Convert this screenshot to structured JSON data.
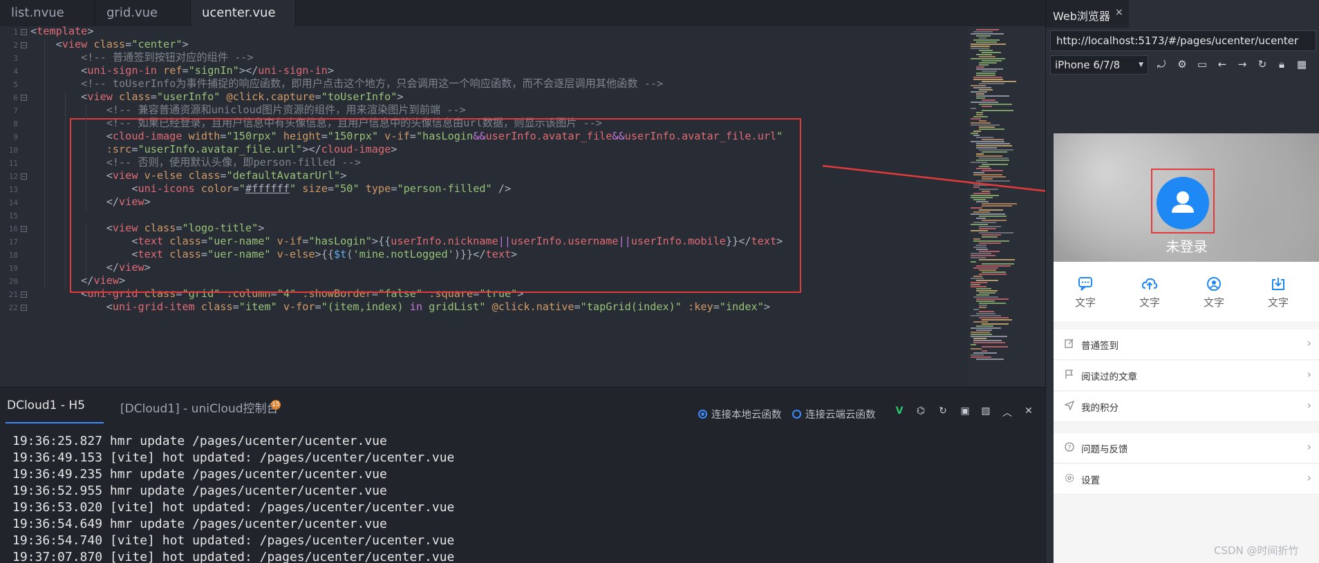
{
  "editor": {
    "tabs": [
      "list.nvue",
      "grid.vue",
      "ucenter.vue"
    ],
    "active_tab": "ucenter.vue",
    "line_numbers": [
      "1",
      "2",
      "3",
      "4",
      "5",
      "6",
      "7",
      "8",
      "9",
      "10",
      "11",
      "12",
      "13",
      "14",
      "15",
      "16",
      "17",
      "18",
      "19",
      "20",
      "21",
      "22"
    ],
    "lines": [
      [
        [
          "t-punc",
          "<"
        ],
        [
          "t-tag",
          "template"
        ],
        [
          "t-punc",
          ">"
        ]
      ],
      [
        [
          "t-plain",
          "    "
        ],
        [
          "t-punc",
          "<"
        ],
        [
          "t-tag",
          "view"
        ],
        [
          "t-plain",
          " "
        ],
        [
          "t-attr",
          "class"
        ],
        [
          "t-punc",
          "="
        ],
        [
          "t-str",
          "\"center\""
        ],
        [
          "t-punc",
          ">"
        ]
      ],
      [
        [
          "t-plain",
          "        "
        ],
        [
          "t-cmt",
          "<!-- 普通签到按钮对应的组件 -->"
        ]
      ],
      [
        [
          "t-plain",
          "        "
        ],
        [
          "t-punc",
          "<"
        ],
        [
          "t-tag",
          "uni-sign-in"
        ],
        [
          "t-plain",
          " "
        ],
        [
          "t-attr",
          "ref"
        ],
        [
          "t-punc",
          "="
        ],
        [
          "t-str",
          "\"signIn\""
        ],
        [
          "t-punc",
          "></"
        ],
        [
          "t-tag",
          "uni-sign-in"
        ],
        [
          "t-punc",
          ">"
        ]
      ],
      [
        [
          "t-plain",
          "        "
        ],
        [
          "t-cmt",
          "<!-- toUserInfo为事件捕捉的响应函数，即用户点击这个地方，只会调用这一个响应函数，而不会逐层调用其他函数 -->"
        ]
      ],
      [
        [
          "t-plain",
          "        "
        ],
        [
          "t-punc",
          "<"
        ],
        [
          "t-tag",
          "view"
        ],
        [
          "t-plain",
          " "
        ],
        [
          "t-attr",
          "class"
        ],
        [
          "t-punc",
          "="
        ],
        [
          "t-str",
          "\"userInfo\""
        ],
        [
          "t-plain",
          " "
        ],
        [
          "t-attr",
          "@click.capture"
        ],
        [
          "t-punc",
          "="
        ],
        [
          "t-str",
          "\"toUserInfo\""
        ],
        [
          "t-punc",
          ">"
        ]
      ],
      [
        [
          "t-plain",
          "            "
        ],
        [
          "t-cmt",
          "<!-- 兼容普通资源和unicloud图片资源的组件，用来渲染图片到前端 -->"
        ]
      ],
      [
        [
          "t-plain",
          "            "
        ],
        [
          "t-cmt",
          "<!-- 如果已经登录，且用户信息中有头像信息，且用户信息中的头像信息由url数据，则显示该图片 -->"
        ]
      ],
      [
        [
          "t-plain",
          "            "
        ],
        [
          "t-punc",
          "<"
        ],
        [
          "t-tag",
          "cloud-image"
        ],
        [
          "t-plain",
          " "
        ],
        [
          "t-attr",
          "width"
        ],
        [
          "t-punc",
          "="
        ],
        [
          "t-str",
          "\"150rpx\""
        ],
        [
          "t-plain",
          " "
        ],
        [
          "t-attr",
          "height"
        ],
        [
          "t-punc",
          "="
        ],
        [
          "t-str",
          "\"150rpx\""
        ],
        [
          "t-plain",
          " "
        ],
        [
          "t-attr",
          "v-if"
        ],
        [
          "t-punc",
          "="
        ],
        [
          "t-str",
          "\"hasLogin"
        ],
        [
          "t-kw",
          "&&"
        ],
        [
          "t-id",
          "userInfo.avatar_file"
        ],
        [
          "t-kw",
          "&&"
        ],
        [
          "t-id",
          "userInfo.avatar_file.url"
        ],
        [
          "t-str",
          "\""
        ]
      ],
      [
        [
          "t-plain",
          "            "
        ],
        [
          "t-attr",
          ":src"
        ],
        [
          "t-punc",
          "="
        ],
        [
          "t-str",
          "\"userInfo.avatar_file.url\""
        ],
        [
          "t-punc",
          "></"
        ],
        [
          "t-tag",
          "cloud-image"
        ],
        [
          "t-punc",
          ">"
        ]
      ],
      [
        [
          "t-plain",
          "            "
        ],
        [
          "t-cmt",
          "<!-- 否则，使用默认头像，即person-filled -->"
        ]
      ],
      [
        [
          "t-plain",
          "            "
        ],
        [
          "t-punc",
          "<"
        ],
        [
          "t-tag",
          "view"
        ],
        [
          "t-plain",
          " "
        ],
        [
          "t-attr",
          "v-else"
        ],
        [
          "t-plain",
          " "
        ],
        [
          "t-attr",
          "class"
        ],
        [
          "t-punc",
          "="
        ],
        [
          "t-str",
          "\"defaultAvatarUrl\""
        ],
        [
          "t-punc",
          ">"
        ]
      ],
      [
        [
          "t-plain",
          "                "
        ],
        [
          "t-punc",
          "<"
        ],
        [
          "t-tag",
          "uni-icons"
        ],
        [
          "t-plain",
          " "
        ],
        [
          "t-attr",
          "color"
        ],
        [
          "t-punc",
          "="
        ],
        [
          "t-str",
          "\""
        ],
        [
          "t-plain u",
          "#ffffff"
        ],
        [
          "t-str",
          "\""
        ],
        [
          "t-plain",
          " "
        ],
        [
          "t-attr",
          "size"
        ],
        [
          "t-punc",
          "="
        ],
        [
          "t-str",
          "\"50\""
        ],
        [
          "t-plain",
          " "
        ],
        [
          "t-attr",
          "type"
        ],
        [
          "t-punc",
          "="
        ],
        [
          "t-str",
          "\"person-filled\""
        ],
        [
          "t-plain",
          " "
        ],
        [
          "t-punc",
          "/>"
        ]
      ],
      [
        [
          "t-plain",
          "            "
        ],
        [
          "t-punc",
          "</"
        ],
        [
          "t-tag",
          "view"
        ],
        [
          "t-punc",
          ">"
        ]
      ],
      [],
      [
        [
          "t-plain",
          "            "
        ],
        [
          "t-punc",
          "<"
        ],
        [
          "t-tag",
          "view"
        ],
        [
          "t-plain",
          " "
        ],
        [
          "t-attr",
          "class"
        ],
        [
          "t-punc",
          "="
        ],
        [
          "t-str",
          "\"logo-title\""
        ],
        [
          "t-punc",
          ">"
        ]
      ],
      [
        [
          "t-plain",
          "                "
        ],
        [
          "t-punc",
          "<"
        ],
        [
          "t-tag",
          "text"
        ],
        [
          "t-plain",
          " "
        ],
        [
          "t-attr",
          "class"
        ],
        [
          "t-punc",
          "="
        ],
        [
          "t-str",
          "\"uer-name\""
        ],
        [
          "t-plain",
          " "
        ],
        [
          "t-attr",
          "v-if"
        ],
        [
          "t-punc",
          "="
        ],
        [
          "t-str",
          "\"hasLogin\""
        ],
        [
          "t-punc",
          ">{{"
        ],
        [
          "t-id",
          "userInfo.nickname"
        ],
        [
          "t-kw",
          "||"
        ],
        [
          "t-id",
          "userInfo.username"
        ],
        [
          "t-kw",
          "||"
        ],
        [
          "t-id",
          "userInfo.mobile"
        ],
        [
          "t-punc",
          "}}</"
        ],
        [
          "t-tag",
          "text"
        ],
        [
          "t-punc",
          ">"
        ]
      ],
      [
        [
          "t-plain",
          "                "
        ],
        [
          "t-punc",
          "<"
        ],
        [
          "t-tag",
          "text"
        ],
        [
          "t-plain",
          " "
        ],
        [
          "t-attr",
          "class"
        ],
        [
          "t-punc",
          "="
        ],
        [
          "t-str",
          "\"uer-name\""
        ],
        [
          "t-plain",
          " "
        ],
        [
          "t-attr",
          "v-else"
        ],
        [
          "t-punc",
          ">{{"
        ],
        [
          "t-fn",
          "$t"
        ],
        [
          "t-punc",
          "("
        ],
        [
          "t-str",
          "'mine.notLogged'"
        ],
        [
          "t-punc",
          ")}}</"
        ],
        [
          "t-tag",
          "text"
        ],
        [
          "t-punc",
          ">"
        ]
      ],
      [
        [
          "t-plain",
          "            "
        ],
        [
          "t-punc",
          "</"
        ],
        [
          "t-tag",
          "view"
        ],
        [
          "t-punc",
          ">"
        ]
      ],
      [
        [
          "t-plain",
          "        "
        ],
        [
          "t-punc",
          "</"
        ],
        [
          "t-tag",
          "view"
        ],
        [
          "t-punc",
          ">"
        ]
      ],
      [
        [
          "t-plain",
          "        "
        ],
        [
          "t-punc",
          "<"
        ],
        [
          "t-tag",
          "uni-grid"
        ],
        [
          "t-plain",
          " "
        ],
        [
          "t-attr",
          "class"
        ],
        [
          "t-punc",
          "="
        ],
        [
          "t-str",
          "\"grid\""
        ],
        [
          "t-plain",
          " "
        ],
        [
          "t-attr",
          ":column"
        ],
        [
          "t-punc",
          "="
        ],
        [
          "t-str",
          "\"4\""
        ],
        [
          "t-plain",
          " "
        ],
        [
          "t-attr",
          ":showBorder"
        ],
        [
          "t-punc",
          "="
        ],
        [
          "t-str",
          "\"false\""
        ],
        [
          "t-plain",
          " "
        ],
        [
          "t-attr",
          ":square"
        ],
        [
          "t-punc",
          "="
        ],
        [
          "t-str",
          "\"true\""
        ],
        [
          "t-punc",
          ">"
        ]
      ],
      [
        [
          "t-plain",
          "            "
        ],
        [
          "t-punc",
          "<"
        ],
        [
          "t-tag",
          "uni-grid-item"
        ],
        [
          "t-plain",
          " "
        ],
        [
          "t-attr",
          "class"
        ],
        [
          "t-punc",
          "="
        ],
        [
          "t-str",
          "\"item\""
        ],
        [
          "t-plain",
          " "
        ],
        [
          "t-attr",
          "v-for"
        ],
        [
          "t-punc",
          "="
        ],
        [
          "t-str",
          "\"(item,index) "
        ],
        [
          "t-kw",
          "in"
        ],
        [
          "t-str",
          " gridList\""
        ],
        [
          "t-plain",
          " "
        ],
        [
          "t-attr",
          "@click.native"
        ],
        [
          "t-punc",
          "="
        ],
        [
          "t-str",
          "\"tapGrid(index)\""
        ],
        [
          "t-plain",
          " "
        ],
        [
          "t-attr",
          ":key"
        ],
        [
          "t-punc",
          "="
        ],
        [
          "t-str",
          "\"index\""
        ],
        [
          "t-punc",
          ">"
        ]
      ]
    ]
  },
  "console": {
    "tab_h5": "DCloud1 - H5",
    "tab_unicloud": "[DCloud1] - uniCloud控制台",
    "badge": "15",
    "opt_local": "连接本地云函数",
    "opt_cloud": "连接云端云函数",
    "logs": [
      "19:36:25.827 hmr update /pages/ucenter/ucenter.vue",
      "19:36:49.153 [vite] hot updated: /pages/ucenter/ucenter.vue",
      "19:36:49.235 hmr update /pages/ucenter/ucenter.vue",
      "19:36:52.955 hmr update /pages/ucenter/ucenter.vue",
      "19:36:53.020 [vite] hot updated: /pages/ucenter/ucenter.vue",
      "19:36:54.649 hmr update /pages/ucenter/ucenter.vue",
      "19:36:54.740 [vite] hot updated: /pages/ucenter/ucenter.vue",
      "19:37:07.870 [vite] hot updated: /pages/ucenter/ucenter.vue"
    ]
  },
  "browser": {
    "tab_title": "Web浏览器",
    "close": "×",
    "url": "http://localhost:5173/#/pages/ucenter/ucenter",
    "device": "iPhone 6/7/8",
    "page": {
      "not_logged": "未登录",
      "grid_label": "文字",
      "grid": [
        "文字",
        "文字",
        "文字",
        "文字"
      ],
      "menu": [
        "普通签到",
        "阅读过的文章",
        "我的积分",
        "问题与反馈",
        "设置"
      ],
      "arrow": "›"
    }
  },
  "watermark": "CSDN @时间折竹",
  "colors": {
    "accent": "#3d8bfd",
    "highlight": "#e03a3a",
    "avatar": "#1e88f5"
  }
}
